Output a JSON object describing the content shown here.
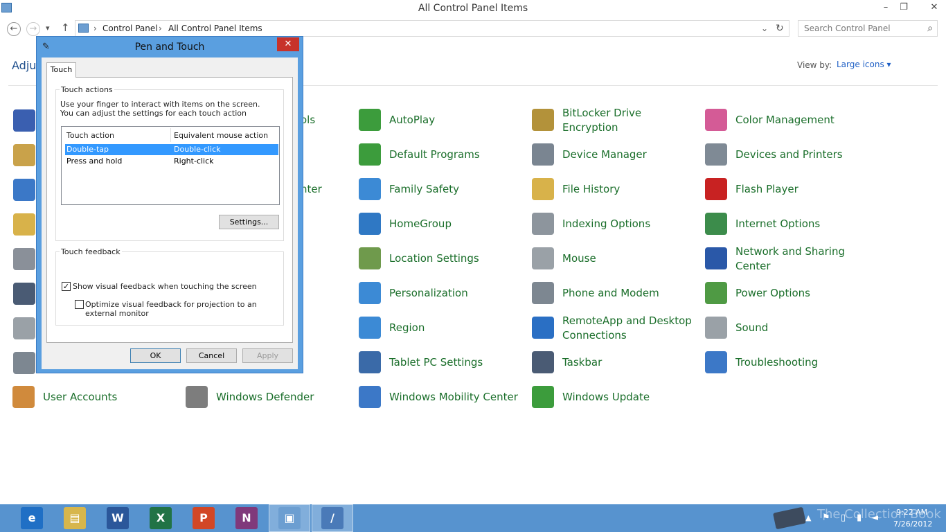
{
  "window": {
    "title": "All Control Panel Items",
    "minimize": "–",
    "restore": "❐",
    "close": "✕"
  },
  "address": {
    "back": "←",
    "forward": "→",
    "recent": "▾",
    "up": "↑",
    "crumbs": [
      "Control Panel",
      "All Control Panel Items"
    ],
    "dropdown": "⌄",
    "refresh": "↻",
    "search_placeholder": "Search Control Panel",
    "search_icon": "⌕"
  },
  "header": {
    "left_partial": "Adjus",
    "view_by_label": "View by:",
    "view_by_value": "Large icons ▾"
  },
  "items": [
    {
      "label": "ols",
      "icon": "flag-icon",
      "color": "#3a5fb0"
    },
    {
      "label": "AutoPlay",
      "icon": "autoplay-icon",
      "color": "#3c9c3c"
    },
    {
      "label": "BitLocker Drive Encryption",
      "icon": "bitlocker-icon",
      "color": "#b3923a"
    },
    {
      "label": "Color Management",
      "icon": "color-management-icon",
      "color": "#d45b96"
    },
    {
      "label": "Default Programs",
      "icon": "default-programs-icon",
      "color": "#3c9c3c"
    },
    {
      "label": "Device Manager",
      "icon": "device-manager-icon",
      "color": "#7a8591"
    },
    {
      "label": "Devices and Printers",
      "icon": "printer-icon",
      "color": "#7f8a95"
    },
    {
      "label": "nter",
      "icon": "monitor-icon",
      "color": "#3b78c7"
    },
    {
      "label": "Family Safety",
      "icon": "family-safety-icon",
      "color": "#3c8ad5"
    },
    {
      "label": "File History",
      "icon": "file-history-icon",
      "color": "#d8b24a"
    },
    {
      "label": "Flash Player",
      "icon": "flash-icon",
      "color": "#c82222"
    },
    {
      "label": "HomeGroup",
      "icon": "homegroup-icon",
      "color": "#2f78c4"
    },
    {
      "label": "Indexing Options",
      "icon": "indexing-icon",
      "color": "#8d959d"
    },
    {
      "label": "Internet Options",
      "icon": "internet-options-icon",
      "color": "#3c8c4b"
    },
    {
      "label": "Location Settings",
      "icon": "location-icon",
      "color": "#6f9a4c"
    },
    {
      "label": "Mouse",
      "icon": "mouse-icon",
      "color": "#9aa1a7"
    },
    {
      "label": "Network and Sharing Center",
      "icon": "network-icon",
      "color": "#2a58a8"
    },
    {
      "label": "Personalization",
      "icon": "personalization-icon",
      "color": "#3c8ad5"
    },
    {
      "label": "Phone and Modem",
      "icon": "phone-icon",
      "color": "#7d8791"
    },
    {
      "label": "Power Options",
      "icon": "power-icon",
      "color": "#4f9a44"
    },
    {
      "label": "Region",
      "icon": "region-icon",
      "color": "#3c8ad5"
    },
    {
      "label": "RemoteApp and Desktop Connections",
      "icon": "remoteapp-icon",
      "color": "#2a6fc4"
    },
    {
      "label": "Sound",
      "icon": "sound-icon",
      "color": "#9aa1a7"
    },
    {
      "label": "Tablet PC Settings",
      "icon": "tablet-icon",
      "color": "#3a6aa8"
    },
    {
      "label": "Taskbar",
      "icon": "taskbar-icon",
      "color": "#4a5b74"
    },
    {
      "label": "Troubleshooting",
      "icon": "troubleshooting-icon",
      "color": "#3c78c7"
    },
    {
      "label": "User Accounts",
      "icon": "user-accounts-icon",
      "color": "#d08a3c"
    },
    {
      "label": "Windows Defender",
      "icon": "defender-icon",
      "color": "#7d7d7d"
    },
    {
      "label": "Windows Mobility Center",
      "icon": "mobility-icon",
      "color": "#3c78c7"
    },
    {
      "label": "Windows Update",
      "icon": "windows-update-icon",
      "color": "#3c9c3c"
    }
  ],
  "left_column_icons": [
    "flag-icon",
    "safe-icon",
    "monitor-icon",
    "folder-check-icon",
    "keyboard-icon",
    "server-icon",
    "storage-icon",
    "microphone-icon"
  ],
  "dialog": {
    "title": "Pen and Touch",
    "close": "✕",
    "tab": "Touch",
    "touch_actions": {
      "group_label": "Touch actions",
      "description": "Use your finger to interact with items on the screen. You can adjust the settings for each touch action",
      "col_action": "Touch action",
      "col_mouse": "Equivalent mouse action",
      "rows": [
        {
          "action": "Double-tap",
          "mouse": "Double-click"
        },
        {
          "action": "Press and hold",
          "mouse": "Right-click"
        }
      ],
      "settings_button": "Settings..."
    },
    "touch_feedback": {
      "group_label": "Touch feedback",
      "show_visual": "Show visual feedback when touching the screen",
      "optimize": "Optimize visual feedback for projection to an external monitor"
    },
    "ok": "OK",
    "cancel": "Cancel",
    "apply": "Apply"
  },
  "taskbar": {
    "apps": [
      {
        "name": "Internet Explorer",
        "glyph": "e",
        "color": "#1f6fc5"
      },
      {
        "name": "File Explorer",
        "glyph": "▤",
        "color": "#d7b64c"
      },
      {
        "name": "Word",
        "glyph": "W",
        "color": "#2b579a"
      },
      {
        "name": "Excel",
        "glyph": "X",
        "color": "#217346"
      },
      {
        "name": "PowerPoint",
        "glyph": "P",
        "color": "#d24726"
      },
      {
        "name": "OneNote",
        "glyph": "N",
        "color": "#80397b"
      },
      {
        "name": "Control Panel",
        "glyph": "▣",
        "color": "#6c9ed1"
      },
      {
        "name": "Pen and Touch",
        "glyph": "/",
        "color": "#4a7ab8"
      }
    ],
    "watermark": "The Collection Book",
    "time": "9:22 AM",
    "date": "7/26/2012"
  }
}
